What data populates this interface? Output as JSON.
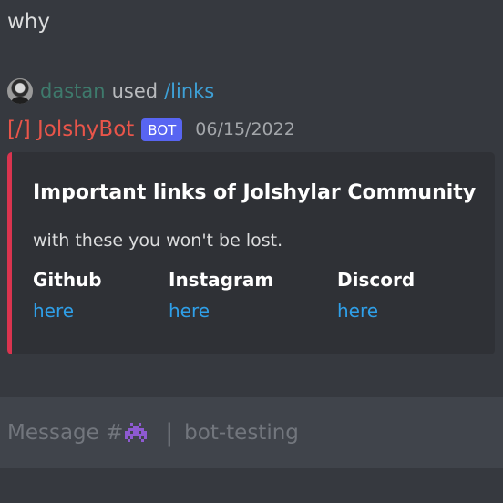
{
  "previous_message": {
    "text": "why"
  },
  "interaction": {
    "username": "dastan",
    "used_label": "used",
    "command": "/links"
  },
  "message": {
    "author": "[/] JolshyBot",
    "bot_tag": "BOT",
    "timestamp": "06/15/2022",
    "embed": {
      "title": "Important links of Jolshylar Community",
      "description": "with these you won't be lost.",
      "accent_color": "#d9344f",
      "fields": [
        {
          "name": "Github",
          "value": "here"
        },
        {
          "name": "Instagram",
          "value": "here"
        },
        {
          "name": "Discord",
          "value": "here"
        }
      ]
    }
  },
  "composer": {
    "placeholder_prefix": "Message #",
    "channel_emoji": "purple-invader-emoji",
    "separator": "|",
    "channel_name": "bot-testing"
  },
  "colors": {
    "background": "#36393f",
    "embed_background": "#2f3136",
    "link": "#2f9fe8",
    "bot_tag": "#5865f2",
    "author": "#e9554a"
  }
}
